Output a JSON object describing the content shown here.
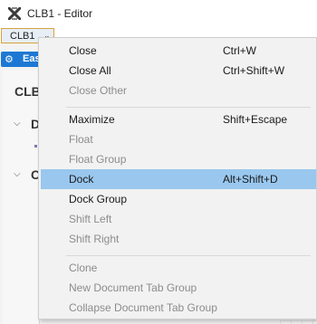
{
  "window": {
    "title": "CLB1 - Editor",
    "app_icon": "x-logo-icon"
  },
  "document_tab": {
    "label": "CLB1",
    "arrow": "⌄"
  },
  "background": {
    "easy_tab": {
      "label": "Eas",
      "icon": "gear-icon"
    },
    "panel_heading": "CLB",
    "section1_letter": "D",
    "section2_letter": "C",
    "close_glyph": "×"
  },
  "menu": {
    "items": [
      {
        "label": "Close",
        "shortcut": "Ctrl+W",
        "enabled": true
      },
      {
        "label": "Close All",
        "shortcut": "Ctrl+Shift+W",
        "enabled": true
      },
      {
        "label": "Close Other",
        "shortcut": "",
        "enabled": false
      },
      {
        "label": "Maximize",
        "shortcut": "Shift+Escape",
        "enabled": true
      },
      {
        "label": "Float",
        "shortcut": "",
        "enabled": false
      },
      {
        "label": "Float Group",
        "shortcut": "",
        "enabled": false
      },
      {
        "label": "Dock",
        "shortcut": "Alt+Shift+D",
        "enabled": true,
        "highlighted": true
      },
      {
        "label": "Dock Group",
        "shortcut": "",
        "enabled": true
      },
      {
        "label": "Shift Left",
        "shortcut": "",
        "enabled": false
      },
      {
        "label": "Shift Right",
        "shortcut": "",
        "enabled": false
      },
      {
        "label": "Clone",
        "shortcut": "",
        "enabled": false
      },
      {
        "label": "New Document Tab Group",
        "shortcut": "",
        "enabled": false
      },
      {
        "label": "Collapse Document Tab Group",
        "shortcut": "",
        "enabled": false
      }
    ]
  },
  "colors": {
    "highlight": "#99c7ee",
    "disabled_text": "#8c8c8c",
    "accent_tab": "#1d78d4"
  }
}
